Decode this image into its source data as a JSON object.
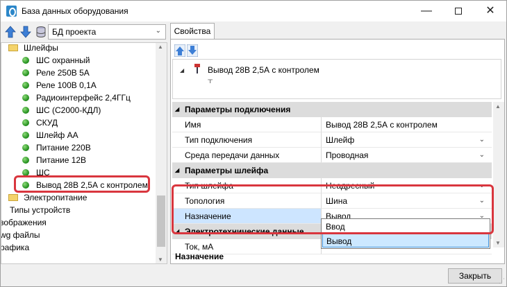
{
  "window": {
    "title": "База данных оборудования",
    "minimize": "—",
    "close": "✕"
  },
  "left": {
    "combo_value": "БД проекта",
    "tree": [
      {
        "label": "Шлейфы",
        "kind": "folder"
      },
      {
        "label": "ШС охранный",
        "kind": "device"
      },
      {
        "label": "Реле 250В 5А",
        "kind": "device"
      },
      {
        "label": "Реле 100В 0,1А",
        "kind": "device"
      },
      {
        "label": "Радиоинтерфейс 2,4ГГц",
        "kind": "device"
      },
      {
        "label": "ШС  (С2000-КДЛ)",
        "kind": "device"
      },
      {
        "label": "СКУД",
        "kind": "device"
      },
      {
        "label": "Шлейф АА",
        "kind": "device"
      },
      {
        "label": "Питание 220В",
        "kind": "device"
      },
      {
        "label": "Питание 12В",
        "kind": "device"
      },
      {
        "label": "ШС",
        "kind": "device"
      },
      {
        "label": "Вывод 28В 2,5А с контролем",
        "kind": "device",
        "selected": true
      },
      {
        "label": "Электропитание",
        "kind": "folder"
      },
      {
        "label": "Типы устройств",
        "kind": "folder"
      },
      {
        "label": "зображения",
        "kind": "folder"
      },
      {
        "label": "wg файлы",
        "kind": "folder"
      },
      {
        "label": "рафика",
        "kind": "folder"
      }
    ]
  },
  "right": {
    "tab_label": "Свойства",
    "header_label": "Вывод 28В 2,5А с контролем",
    "grid": {
      "cat_connection": "Параметры подключения",
      "name_label": "Имя",
      "name_value": "Вывод 28В 2,5А с контролем",
      "conn_type_label": "Тип подключения",
      "conn_type_value": "Шлейф",
      "medium_label": "Среда передачи данных",
      "medium_value": "Проводная",
      "cat_loop": "Параметры шлейфа",
      "loop_type_label": "Тип шлейфа",
      "loop_type_value": "Неадресный",
      "topology_label": "Топология",
      "topology_value": "Шина",
      "purpose_label": "Назначение",
      "purpose_value": "Вывод",
      "cat_electric": "Электротехнические данные",
      "current_label": "Ток, мА"
    },
    "dropdown_options": [
      "Ввод",
      "Вывод"
    ],
    "description_title": "Назначение"
  },
  "footer": {
    "close_button": "Закрыть"
  },
  "colors": {
    "highlight": "#d9363e",
    "selection": "#cde5ff",
    "category_bg": "#dcdcdc"
  }
}
